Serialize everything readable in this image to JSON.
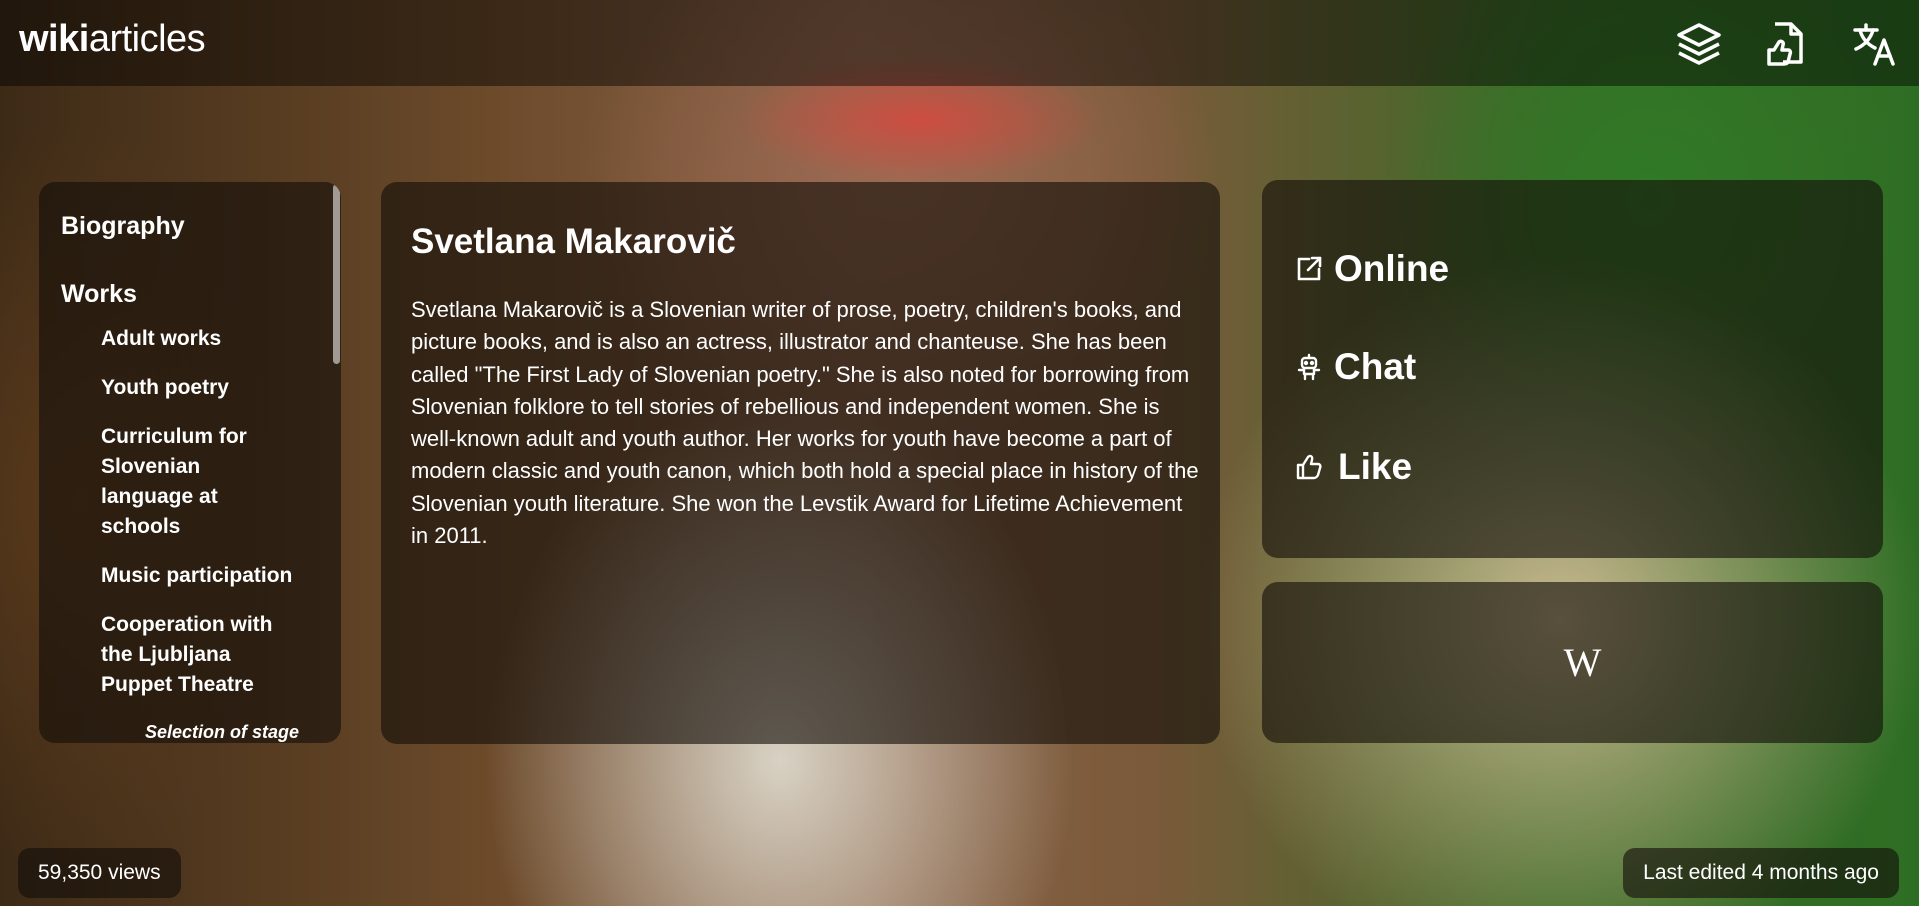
{
  "header": {
    "logo_bold": "wiki",
    "logo_light": "articles",
    "icons": [
      "layers-icon",
      "document-like-icon",
      "translate-icon"
    ]
  },
  "toc": {
    "items": [
      {
        "label": "Biography",
        "level": 1
      },
      {
        "label": "Works",
        "level": 1
      },
      {
        "label": "Adult works",
        "level": 2
      },
      {
        "label": "Youth poetry",
        "level": 2
      },
      {
        "label": "Curriculum for Slovenian language at schools",
        "level": 2
      },
      {
        "label": "Music participation",
        "level": 2
      },
      {
        "label": "Cooperation with the Ljubljana Puppet Theatre",
        "level": 2
      },
      {
        "label": "Selection of stage acts from",
        "level": 3
      }
    ]
  },
  "article": {
    "title": "Svetlana Makarovič",
    "summary": "Svetlana Makarovič is a Slovenian writer of prose, poetry, children's books, and picture books, and is also an actress, illustrator and chanteuse. She has been called \"The First Lady of Slovenian poetry.\" She is also noted for borrowing from Slovenian folklore to tell stories of rebellious and independent women. She is well-known adult and youth author. Her works for youth have become a part of modern classic and youth canon, which both hold a special place in history of the Slovenian youth literature. She won the Levstik Award for Lifetime Achievement in 2011."
  },
  "actions": {
    "online": {
      "label": "Online",
      "icon": "external-link-icon"
    },
    "chat": {
      "label": "Chat",
      "icon": "robot-icon"
    },
    "like": {
      "label": "Like",
      "icon": "thumbs-up-icon"
    }
  },
  "wiki_link": {
    "glyph": "W",
    "icon": "wikipedia-icon"
  },
  "footer": {
    "views": "59,350 views",
    "last_edited": "Last edited 4 months ago"
  }
}
